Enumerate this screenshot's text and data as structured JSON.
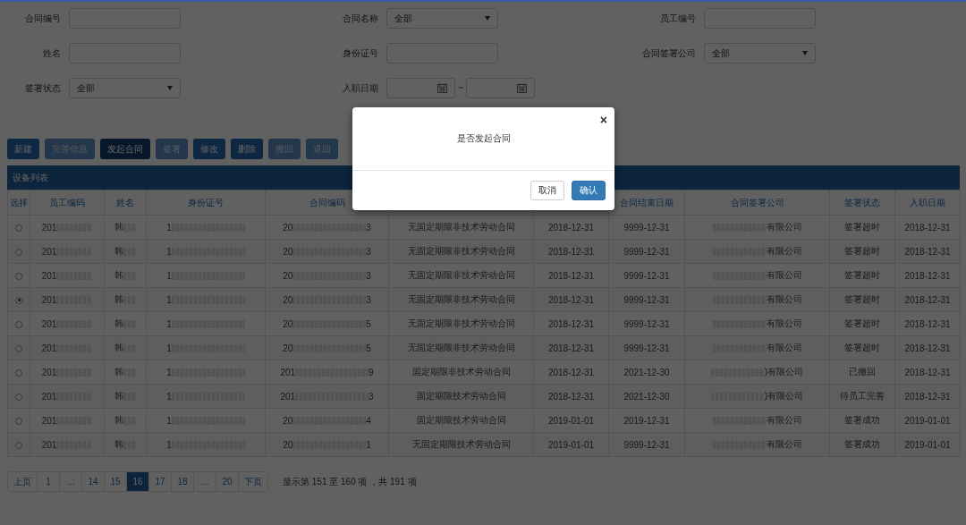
{
  "filters": [
    {
      "label": "合同编号",
      "kind": "text"
    },
    {
      "label": "合同名称",
      "kind": "select",
      "value": "全部"
    },
    {
      "label": "员工编号",
      "kind": "text"
    },
    {
      "label": "姓名",
      "kind": "text"
    },
    {
      "label": "身份证号",
      "kind": "text"
    },
    {
      "label": "合同签署公司",
      "kind": "select",
      "value": "全部"
    },
    {
      "label": "签署状态",
      "kind": "select",
      "value": "全部"
    },
    {
      "label": "入职日期",
      "kind": "daterange",
      "separator": "~"
    }
  ],
  "toolbar": [
    {
      "label": "新建",
      "disabled": false,
      "pressed": false
    },
    {
      "label": "完善信息",
      "disabled": true,
      "pressed": false
    },
    {
      "label": "发起合同",
      "disabled": false,
      "pressed": true
    },
    {
      "label": "签署",
      "disabled": true,
      "pressed": false
    },
    {
      "label": "修改",
      "disabled": false,
      "pressed": false
    },
    {
      "label": "删除",
      "disabled": false,
      "pressed": false
    },
    {
      "label": "撤回",
      "disabled": true,
      "pressed": false
    },
    {
      "label": "退回",
      "disabled": true,
      "pressed": false
    }
  ],
  "table": {
    "title": "设备列表",
    "columns": [
      "选择",
      "员工编码",
      "姓名",
      "身份证号",
      "合同编码",
      null,
      null,
      "合同结束日期",
      "合同签署公司",
      "签署状态",
      "入职日期"
    ],
    "rows": [
      {
        "selected": false,
        "employee_code": "201",
        "name": "韩",
        "id_number": "1",
        "contract_code": {
          "prefix": "20",
          "suffix": "3"
        },
        "column_6": "无固定期限非技术劳动合同",
        "column_7": "2018-12-31",
        "end_date": "9999-12-31",
        "company": "有限公司",
        "status": "签署超时",
        "entry_date": "2018-12-31"
      },
      {
        "selected": false,
        "employee_code": "201",
        "name": "韩",
        "id_number": "1",
        "contract_code": {
          "prefix": "20",
          "suffix": "3"
        },
        "column_6": "无固定期限非技术劳动合同",
        "column_7": "2018-12-31",
        "end_date": "9999-12-31",
        "company": "有限公司",
        "status": "签署超时",
        "entry_date": "2018-12-31"
      },
      {
        "selected": false,
        "employee_code": "201",
        "name": "韩",
        "id_number": "1",
        "contract_code": {
          "prefix": "20",
          "suffix": "3"
        },
        "column_6": "无固定期限非技术劳动合同",
        "column_7": "2018-12-31",
        "end_date": "9999-12-31",
        "company": "有限公司",
        "status": "签署超时",
        "entry_date": "2018-12-31"
      },
      {
        "selected": true,
        "employee_code": "201",
        "name": "韩",
        "id_number": "1",
        "contract_code": {
          "prefix": "20",
          "suffix": "3"
        },
        "column_6": "无固定期限非技术劳动合同",
        "column_7": "2018-12-31",
        "end_date": "9999-12-31",
        "company": "有限公司",
        "status": "签署超时",
        "entry_date": "2018-12-31"
      },
      {
        "selected": false,
        "employee_code": "201",
        "name": "韩",
        "id_number": "1",
        "contract_code": {
          "prefix": "20",
          "suffix": "5"
        },
        "column_6": "无固定期限非技术劳动合同",
        "column_7": "2018-12-31",
        "end_date": "9999-12-31",
        "company": "有限公司",
        "status": "签署超时",
        "entry_date": "2018-12-31"
      },
      {
        "selected": false,
        "employee_code": "201",
        "name": "韩",
        "id_number": "1",
        "contract_code": {
          "prefix": "20",
          "suffix": "5"
        },
        "column_6": "无固定期限非技术劳动合同",
        "column_7": "2018-12-31",
        "end_date": "9999-12-31",
        "company": "有限公司",
        "status": "签署超时",
        "entry_date": "2018-12-31"
      },
      {
        "selected": false,
        "employee_code": "201",
        "name": "韩",
        "id_number": "1",
        "contract_code": {
          "prefix": "201",
          "suffix": "9"
        },
        "column_6": "固定期限非技术劳动合同",
        "column_7": "2018-12-31",
        "end_date": "2021-12-30",
        "company": ")有限公司",
        "status": "已撤回",
        "entry_date": "2018-12-31"
      },
      {
        "selected": false,
        "employee_code": "201",
        "name": "韩",
        "id_number": "1",
        "contract_code": {
          "prefix": "201",
          "suffix": "3"
        },
        "column_6": "固定期限技术劳动合同",
        "column_7": "2018-12-31",
        "end_date": "2021-12-30",
        "company": ")有限公司",
        "status": "待员工完善",
        "entry_date": "2018-12-31"
      },
      {
        "selected": false,
        "employee_code": "201",
        "name": "韩",
        "id_number": "1",
        "contract_code": {
          "prefix": "20",
          "suffix": "4"
        },
        "column_6": "固定期限技术劳动合同",
        "column_7": "2019-01-01",
        "end_date": "2019-12-31",
        "company": "有限公司",
        "status": "签署成功",
        "entry_date": "2019-01-01"
      },
      {
        "selected": false,
        "employee_code": "201",
        "name": "韩",
        "id_number": "1",
        "contract_code": {
          "prefix": "20",
          "suffix": "1"
        },
        "column_6": "无固定期限技术劳动合同",
        "column_7": "2019-01-01",
        "end_date": "9999-12-31",
        "company": "有限公司",
        "status": "签署成功",
        "entry_date": "2019-01-01"
      }
    ]
  },
  "pagination": {
    "pages": [
      {
        "label": "上页",
        "selected": false
      },
      {
        "label": "1",
        "selected": false
      },
      {
        "label": "…",
        "selected": false
      },
      {
        "label": "14",
        "selected": false
      },
      {
        "label": "15",
        "selected": false
      },
      {
        "label": "16",
        "selected": true
      },
      {
        "label": "17",
        "selected": false
      },
      {
        "label": "18",
        "selected": false
      },
      {
        "label": "…",
        "selected": false
      },
      {
        "label": "20",
        "selected": false
      },
      {
        "label": "下页",
        "selected": false
      }
    ],
    "info": "显示第 151 至 160 项 ，共 191 项"
  },
  "dialog": {
    "message": "是否发起合同",
    "close": "×",
    "buttons": [
      {
        "label": "取消",
        "kind": "default"
      },
      {
        "label": "确认",
        "kind": "primary"
      }
    ]
  }
}
